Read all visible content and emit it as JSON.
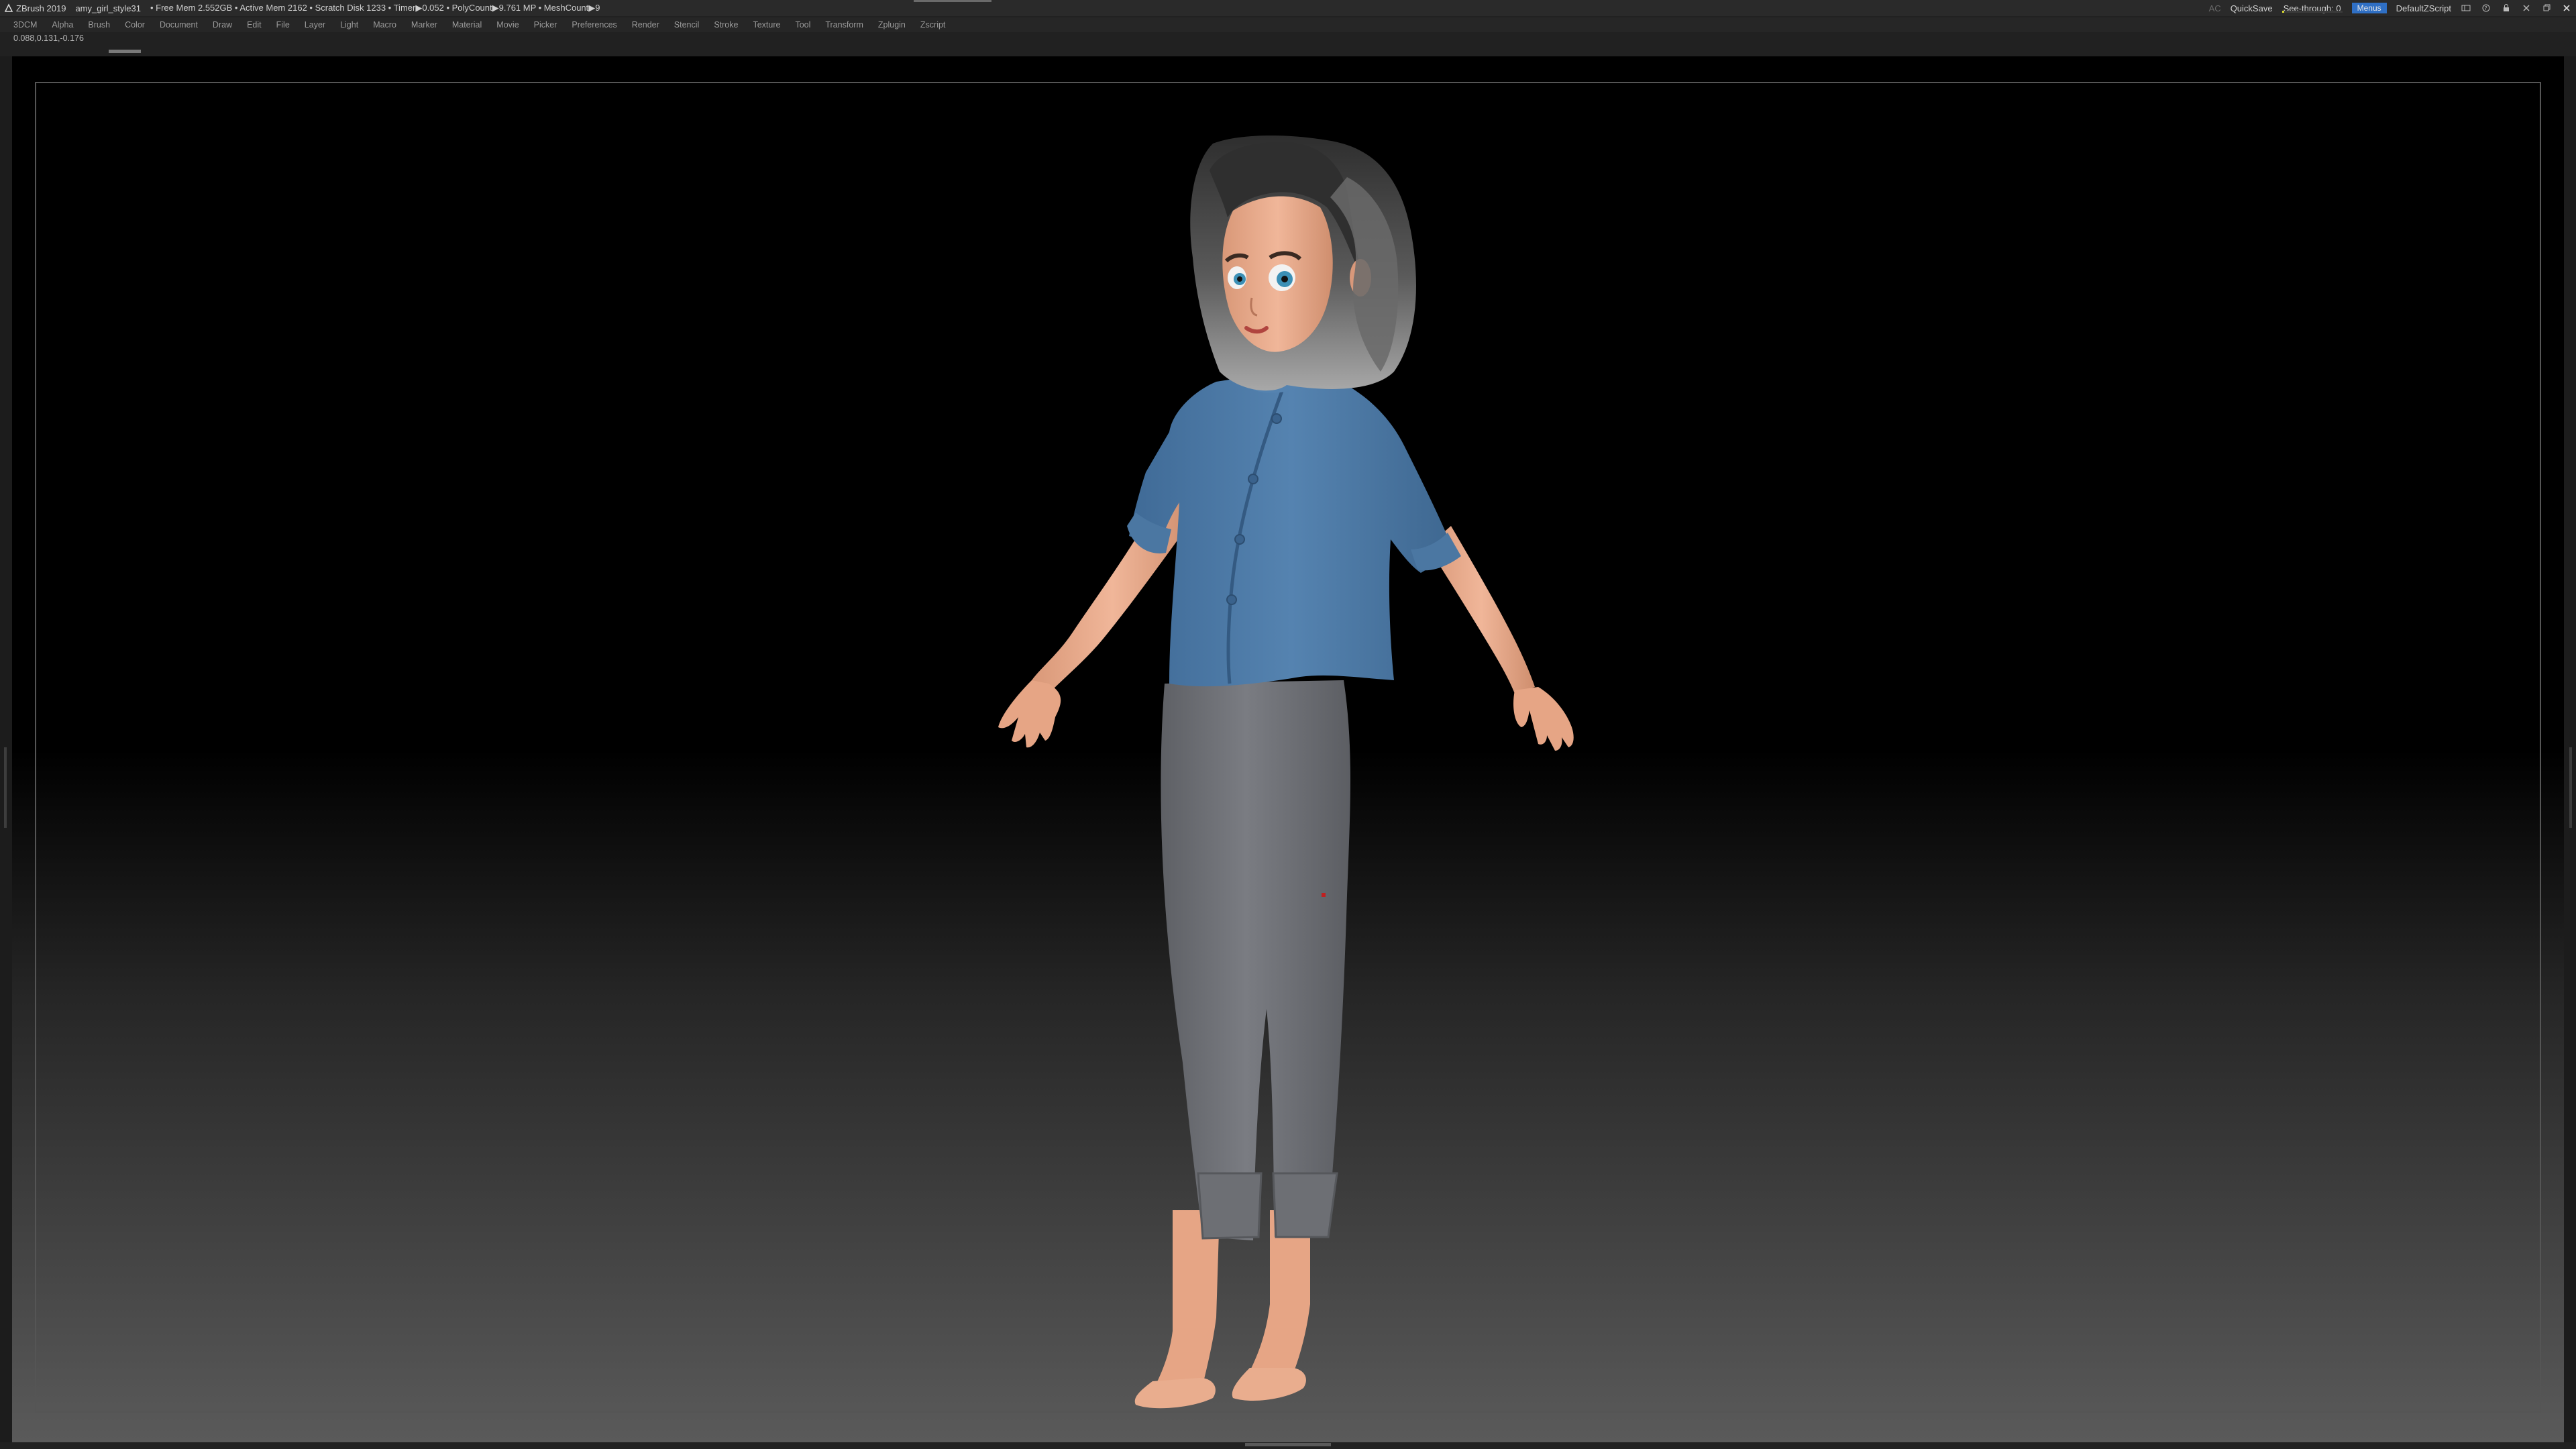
{
  "titlebar": {
    "app_name": "ZBrush 2019",
    "file_name": "amy_girl_style31",
    "stats": "• Free Mem 2.552GB • Active Mem 2162 • Scratch Disk 1233 • Timer▶0.052 • PolyCount▶9.761 MP • MeshCount▶9",
    "ac_label": "AC",
    "quicksave_label": "QuickSave",
    "seethrough_label": "See-through",
    "seethrough_value": "0",
    "seethrough_fraction": 0.0,
    "menus_label": "Menus",
    "script_label": "DefaultZScript"
  },
  "menubar": {
    "items": [
      "3DCM",
      "Alpha",
      "Brush",
      "Color",
      "Document",
      "Draw",
      "Edit",
      "File",
      "Layer",
      "Light",
      "Macro",
      "Marker",
      "Material",
      "Movie",
      "Picker",
      "Preferences",
      "Render",
      "Stencil",
      "Stroke",
      "Texture",
      "Tool",
      "Transform",
      "Zplugin",
      "Zscript"
    ]
  },
  "status": {
    "coords": "0.088,0.131,-0.176"
  },
  "icons": {
    "logo": "zbrush-logo-icon",
    "window_controls": [
      "layout-icon",
      "help-icon",
      "lock-icon",
      "minimize-icon",
      "restore-icon",
      "close-icon"
    ]
  },
  "colors": {
    "accent": "#2f6fc4",
    "seethrough_bar": "#d4d430",
    "shirt": "#4f7aa5",
    "pants": "#6f7176",
    "skin": "#e8a888",
    "hair": "#4a4a4a"
  }
}
